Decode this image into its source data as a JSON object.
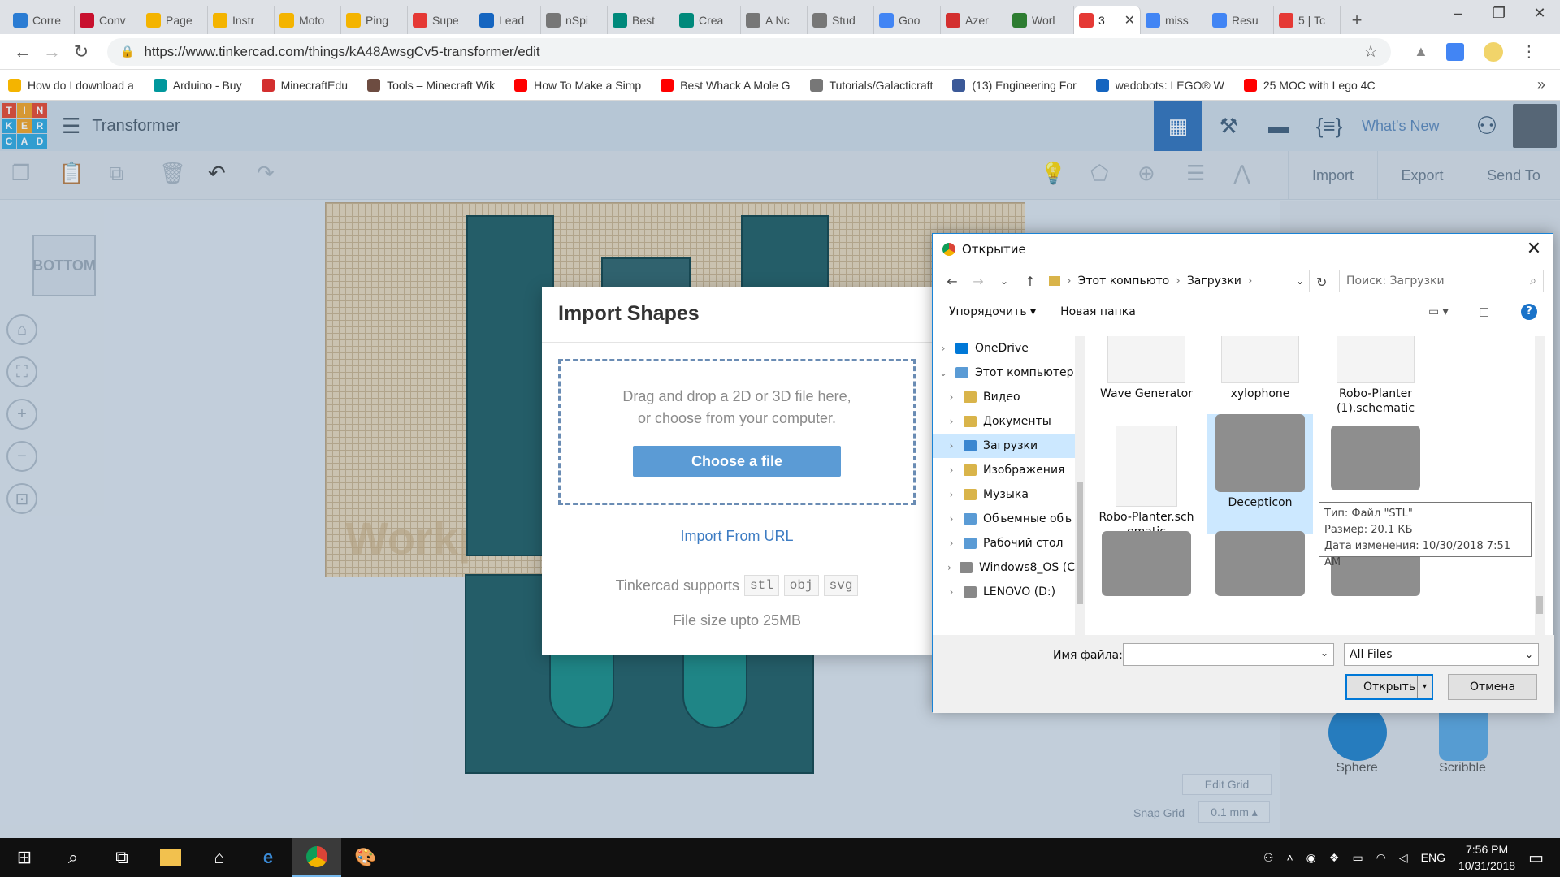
{
  "browser": {
    "tabs": [
      {
        "label": "Corre",
        "color": "#2b7cd3"
      },
      {
        "label": "Conv",
        "color": "#c8102e"
      },
      {
        "label": "Page",
        "color": "#f4b400"
      },
      {
        "label": "Instr",
        "color": "#f4b400"
      },
      {
        "label": "Moto",
        "color": "#f4b400"
      },
      {
        "label": "Ping",
        "color": "#f4b400"
      },
      {
        "label": "Supe",
        "color": "#e53935"
      },
      {
        "label": "Lead",
        "color": "#1565c0"
      },
      {
        "label": "nSpi",
        "color": "#777777"
      },
      {
        "label": "Best",
        "color": "#00897b"
      },
      {
        "label": "Crea",
        "color": "#00897b"
      },
      {
        "label": "A Nc",
        "color": "#777777"
      },
      {
        "label": "Stud",
        "color": "#777777"
      },
      {
        "label": "Goo",
        "color": "#4285f4"
      },
      {
        "label": "Azer",
        "color": "#d32f2f"
      },
      {
        "label": "Worl",
        "color": "#2e7d32"
      },
      {
        "label": "3",
        "color": "#e53935",
        "active": true
      },
      {
        "label": "miss",
        "color": "#4285f4"
      },
      {
        "label": "Resu",
        "color": "#4285f4"
      },
      {
        "label": "5 | Tc",
        "color": "#e53935"
      }
    ],
    "url": "https://www.tinkercad.com/things/kA48AwsgCv5-transformer/edit",
    "bookmarks": [
      {
        "label": "How do I download a",
        "color": "#f4b400"
      },
      {
        "label": "Arduino - Buy",
        "color": "#00979c"
      },
      {
        "label": "MinecraftEdu",
        "color": "#d32f2f"
      },
      {
        "label": "Tools – Minecraft Wik",
        "color": "#6d4c41"
      },
      {
        "label": "How To Make a Simp",
        "color": "#ff0000"
      },
      {
        "label": "Best Whack A Mole G",
        "color": "#ff0000"
      },
      {
        "label": "Tutorials/Galacticraft",
        "color": "#777777"
      },
      {
        "label": "(13) Engineering For",
        "color": "#3b5998"
      },
      {
        "label": "wedobots: LEGO® W",
        "color": "#1565c0"
      },
      {
        "label": "25 MOC with Lego 4C",
        "color": "#ff0000"
      }
    ],
    "more": "»"
  },
  "tinkercad": {
    "logo_letters": [
      "T",
      "I",
      "N",
      "K",
      "E",
      "R",
      "C",
      "A",
      "D"
    ],
    "logo_colors": [
      "#e8442a",
      "#f6a21e",
      "#e8442a",
      "#2da8dd",
      "#f6a21e",
      "#2da8dd",
      "#2da8dd",
      "#2da8dd",
      "#2da8dd"
    ],
    "design_title": "Transformer",
    "whats_new": "What's New",
    "toolbar": {
      "import": "Import",
      "export": "Export",
      "send_to": "Send To"
    },
    "viewcube_label": "BOTTOM",
    "workplane_text": "Workp",
    "shapes": [
      "Sphere",
      "Scribble"
    ],
    "edit_grid": "Edit Grid",
    "snap_grid_label": "Snap Grid",
    "snap_grid_value": "0.1 mm"
  },
  "modal": {
    "title": "Import Shapes",
    "drop_line1": "Drag and drop a 2D or 3D file here,",
    "drop_line2": "or choose from your computer.",
    "choose_btn": "Choose a file",
    "import_url": "Import From URL",
    "supports_label": "Tinkercad supports",
    "formats": [
      "stl",
      "obj",
      "svg"
    ],
    "size_info": "File size upto 25MB"
  },
  "dialog": {
    "title": "Открытие",
    "crumbs": [
      "Этот компьюто",
      "Загрузки"
    ],
    "search_placeholder": "Поиск: Загрузки",
    "organize": "Упорядочить",
    "new_folder": "Новая папка",
    "tree": [
      {
        "label": "OneDrive",
        "color": "#0078d7",
        "level": 0,
        "chev": ">"
      },
      {
        "label": "Этот компьютер",
        "color": "#5a9bd5",
        "level": 0,
        "chev": "v"
      },
      {
        "label": "Видео",
        "color": "#d9b44a",
        "level": 1,
        "chev": ">"
      },
      {
        "label": "Документы",
        "color": "#d9b44a",
        "level": 1,
        "chev": ">"
      },
      {
        "label": "Загрузки",
        "color": "#3a86d0",
        "level": 1,
        "chev": ">",
        "selected": true
      },
      {
        "label": "Изображения",
        "color": "#d9b44a",
        "level": 1,
        "chev": ">"
      },
      {
        "label": "Музыка",
        "color": "#d9b44a",
        "level": 1,
        "chev": ">"
      },
      {
        "label": "Объемные объ",
        "color": "#5a9bd5",
        "level": 1,
        "chev": ">"
      },
      {
        "label": "Рабочий стол",
        "color": "#5a9bd5",
        "level": 1,
        "chev": ">"
      },
      {
        "label": "Windows8_OS (C",
        "color": "#888888",
        "level": 1,
        "chev": ">"
      },
      {
        "label": "LENOVO (D:)",
        "color": "#888888",
        "level": 1,
        "chev": ">"
      }
    ],
    "files": [
      {
        "name": "Wave Generator"
      },
      {
        "name": "xylophone"
      },
      {
        "name": "Robo-Planter (1).schematic"
      },
      {
        "name": "Robo-Planter.sch ematic"
      },
      {
        "name": "Decepticon"
      },
      {
        "name": ""
      },
      {
        "name": ""
      },
      {
        "name": ""
      },
      {
        "name": ""
      }
    ],
    "tooltip": {
      "type": "Тип: Файл \"STL\"",
      "size": "Размер: 20.1 КБ",
      "date": "Дата изменения: 10/30/2018 7:51 AM"
    },
    "filename_label": "Имя файла:",
    "filetype": "All Files",
    "open_btn": "Открыть",
    "cancel_btn": "Отмена"
  },
  "taskbar": {
    "lang": "ENG",
    "time": "7:56 PM",
    "date": "10/31/2018"
  }
}
